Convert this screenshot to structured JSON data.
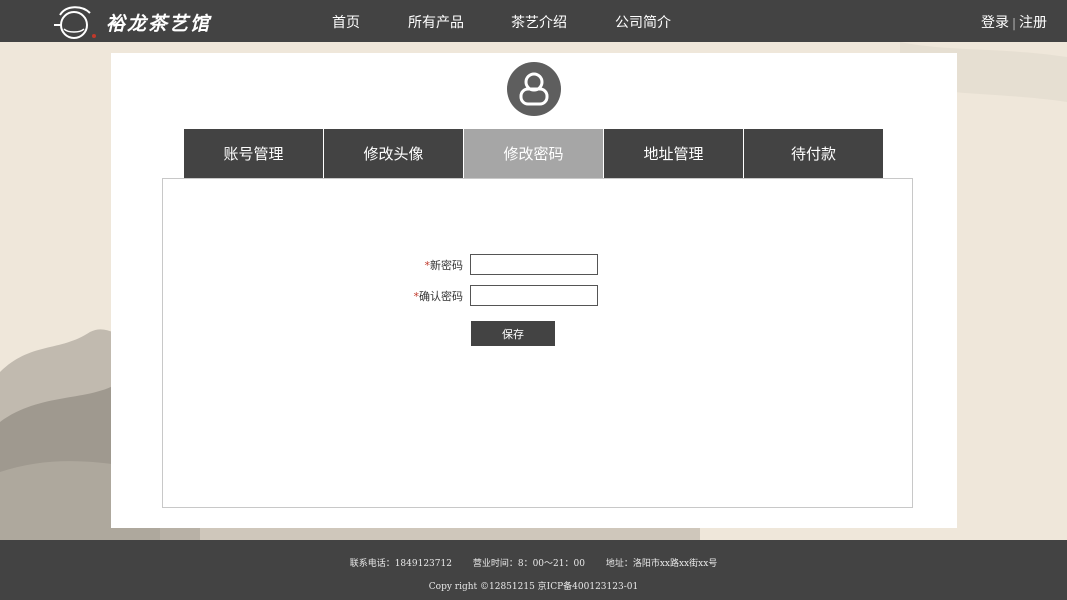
{
  "header": {
    "brand": "裕龙茶艺馆",
    "nav": [
      {
        "label": "首页"
      },
      {
        "label": "所有产品"
      },
      {
        "label": "茶艺介绍"
      },
      {
        "label": "公司简介"
      }
    ],
    "login": "登录",
    "separator": "|",
    "register": "注册"
  },
  "profile": {
    "avatar_icon": "user-icon",
    "tabs": [
      {
        "label": "账号管理",
        "active": false
      },
      {
        "label": "修改头像",
        "active": false
      },
      {
        "label": "修改密码",
        "active": true
      },
      {
        "label": "地址管理",
        "active": false
      },
      {
        "label": "待付款",
        "active": false
      }
    ],
    "form": {
      "required_mark": "*",
      "new_password_label": "新密码",
      "new_password_value": "",
      "confirm_password_label": "确认密码",
      "confirm_password_value": "",
      "save_label": "保存"
    }
  },
  "footer": {
    "phone": "联系电话：1849123712",
    "hours": "营业时间：8：00～21：00",
    "address": "地址：洛阳市xx路xx街xx号",
    "copyright": "Copy right ©12851215 京ICP备400123123-01"
  },
  "colors": {
    "header_bg": "#434343",
    "active_tab": "#a6a6a6",
    "page_bg": "#efe7da",
    "required": "#c0392b"
  }
}
